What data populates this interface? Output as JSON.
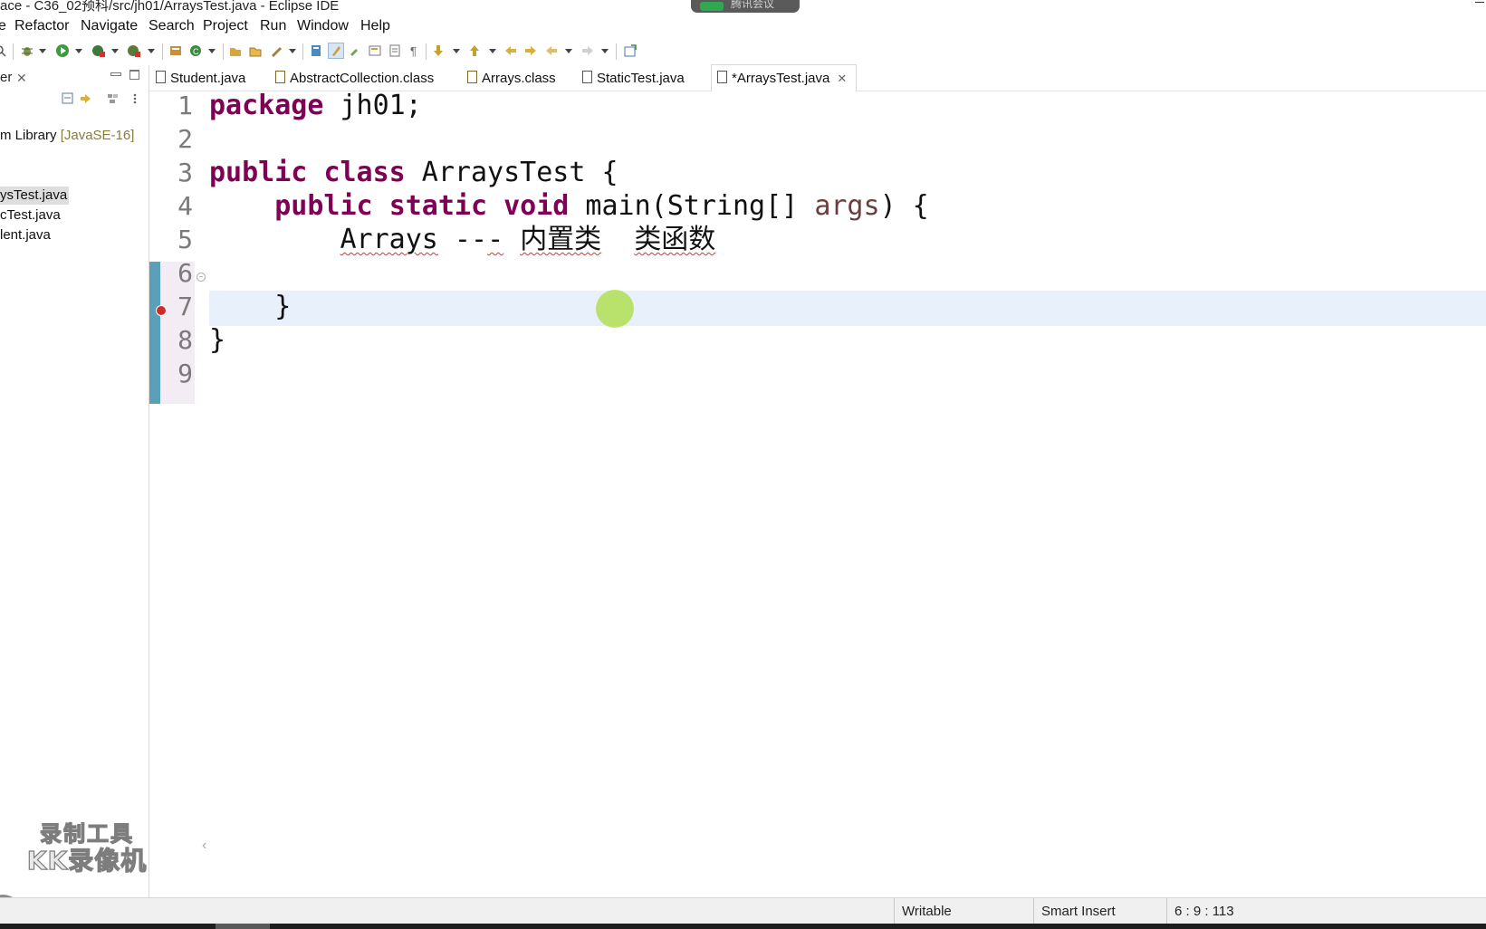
{
  "window": {
    "title": "ace - C36_02预科/src/jh01/ArraysTest.java - Eclipse IDE",
    "meeting_pill_text": "腾讯会议"
  },
  "menubar": {
    "items": [
      {
        "label": "e"
      },
      {
        "label": "Refactor"
      },
      {
        "label": "Navigate"
      },
      {
        "label": "Search"
      },
      {
        "label": "Project"
      },
      {
        "label": "Run"
      },
      {
        "label": "Window"
      },
      {
        "label": "Help"
      }
    ]
  },
  "left_panel": {
    "view_title": "er",
    "tree": [
      {
        "label": "m Library ",
        "tag": "[JavaSE-16]"
      },
      {
        "label": "ysTest.java",
        "selected": true
      },
      {
        "label": "cTest.java"
      },
      {
        "label": "lent.java"
      }
    ],
    "watermark": {
      "line1": "录制工具",
      "line2": "KK录像机"
    },
    "collapse_glyph": "‹"
  },
  "editor": {
    "tabs": [
      {
        "label": "Student.java",
        "kind": "java"
      },
      {
        "label": "AbstractCollection.class",
        "kind": "class"
      },
      {
        "label": "Arrays.class",
        "kind": "class"
      },
      {
        "label": "StaticTest.java",
        "kind": "java"
      },
      {
        "label": "*ArraysTest.java",
        "kind": "java",
        "active": true
      }
    ],
    "close_glyph": "✕",
    "line_numbers": [
      "1",
      "2",
      "3",
      "4",
      "5",
      "6",
      "7",
      "8",
      "9"
    ],
    "lines": {
      "l1_kw": "package",
      "l1_rest": " jh01;",
      "l3_kw1": "public",
      "l3_kw2": "class",
      "l3_rest": " ArraysTest {",
      "l4_kw1": "public",
      "l4_kw2": "static",
      "l4_kw3": "void",
      "l4_mid": " main(String[] ",
      "l4_param": "args",
      "l4_end": ") {",
      "l5_a": "Arrays",
      "l5_b": " --",
      "l5_c": "-",
      "l5_d": " ",
      "l5_e": "内置类",
      "l5_f": "  ",
      "l5_g": "类函数",
      "l7": "}",
      "l8": "}"
    },
    "scroll_left_glyph": "‹"
  },
  "statusbar": {
    "writable": "Writable",
    "insert_mode": "Smart Insert",
    "position": "6 : 9 : 113"
  }
}
